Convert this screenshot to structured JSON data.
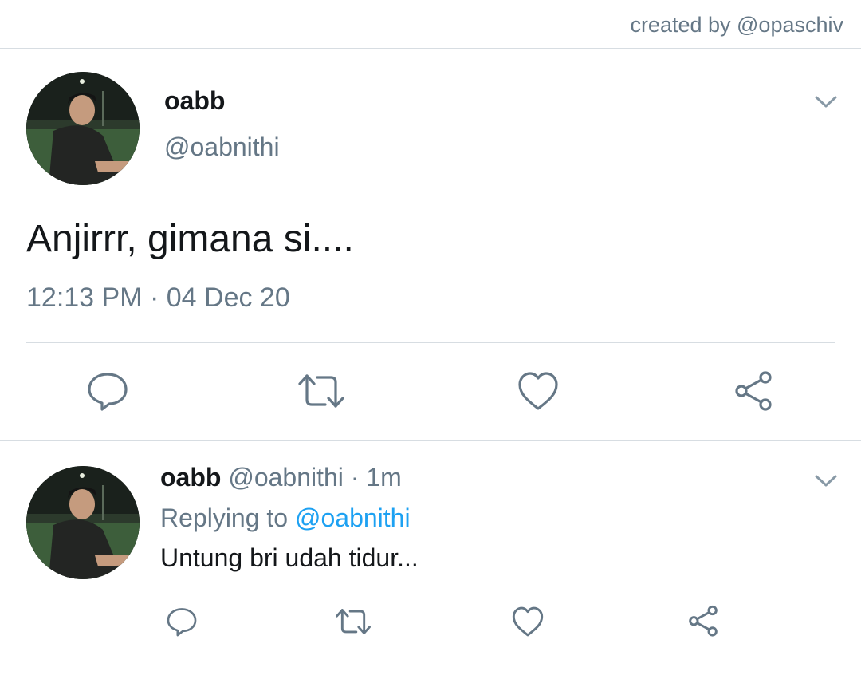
{
  "credit": "created by @opaschiv",
  "main_tweet": {
    "name": "oabb",
    "handle": "@oabnithi",
    "text": "Anjirrr, gimana si....",
    "timestamp": "12:13 PM · 04 Dec 20",
    "actions": [
      "reply-icon",
      "retweet-icon",
      "like-icon",
      "share-icon"
    ],
    "menu_icon": "chevron-down-icon"
  },
  "reply_tweet": {
    "name": "oabb",
    "handle": "@oabnithi",
    "separator": "·",
    "time": "1m",
    "replying_prefix": "Replying to",
    "replying_to": "@oabnithi",
    "text": "Untung bri udah tidur...",
    "actions": [
      "reply-icon",
      "retweet-icon",
      "like-icon",
      "share-icon"
    ],
    "menu_icon": "chevron-down-icon"
  },
  "colors": {
    "text": "#14171a",
    "secondary": "#657786",
    "link": "#1da1f2",
    "divider": "#d7dde2",
    "icon": "#657786"
  }
}
